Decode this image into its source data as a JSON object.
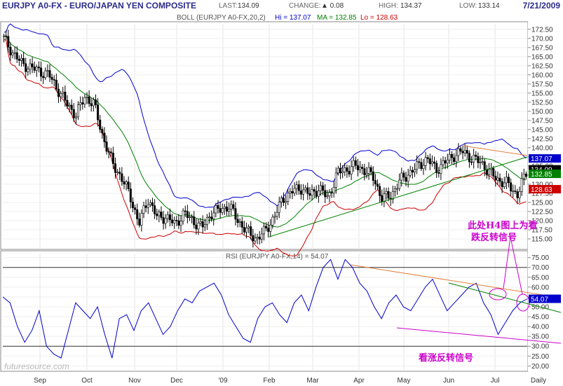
{
  "header": {
    "title": "EURJPY A0-FX - EURO/JAPAN YEN COMPOSITE",
    "last_label": "LAST:",
    "last_value": "134.09",
    "change_label": "CHANGE:",
    "change_value": "▲ 0.08",
    "high_label": "HIGH:",
    "high_value": "134.37",
    "low_label": "LOW:",
    "low_value": "133.14",
    "date": "7/21/2009"
  },
  "colors": {
    "upper_band": "#0000cc",
    "moving_avg": "#008000",
    "lower_band": "#cc0000",
    "rsi": "#0000cc",
    "trend_orange": "#e08040",
    "trend_green": "#008000",
    "annotation": "#cc00cc",
    "price": "#000000"
  },
  "chart_data": [
    {
      "type": "candlestick",
      "legend": {
        "prefix": "BOLL (EURJPY A0-FX,20,2)",
        "hi": "Hi = 137.07",
        "ma": "MA = 132.85",
        "lo": "Lo = 128.63"
      },
      "y_ticks": [
        "172.50",
        "170.00",
        "167.50",
        "165.00",
        "162.50",
        "160.00",
        "157.50",
        "155.00",
        "152.50",
        "150.00",
        "147.50",
        "145.00",
        "142.50",
        "140.00",
        "137.50",
        "135.00",
        "132.50",
        "130.00",
        "127.50",
        "125.00",
        "122.50",
        "120.00",
        "117.50",
        "115.00"
      ],
      "ylim": [
        112.5,
        174
      ],
      "last_tags": [
        {
          "text": "137.07",
          "color": "#0000cc",
          "value": 137.07
        },
        {
          "text": "134.09",
          "color": "#000000",
          "value": 134.09
        },
        {
          "text": "132.85",
          "color": "#008000",
          "value": 132.85
        },
        {
          "text": "128.63",
          "color": "#cc0000",
          "value": 128.63
        }
      ],
      "x_labels": [
        "Sep",
        "Oct",
        "Nov",
        "Dec",
        "'09",
        "Feb",
        "Mar",
        "Apr",
        "May",
        "Jun",
        "Jul",
        "Daily"
      ],
      "close_series": [
        170,
        166,
        163,
        162,
        161,
        160,
        156,
        152,
        149,
        154,
        152,
        143,
        136,
        132,
        127,
        119,
        126,
        121,
        121,
        119,
        122,
        120,
        118,
        122,
        123,
        124,
        120,
        117,
        115,
        117,
        121,
        126,
        128,
        129,
        127,
        129,
        126,
        133,
        134,
        135,
        134,
        132,
        126,
        127,
        131,
        133,
        135,
        137,
        134,
        136,
        138,
        139,
        137,
        136,
        133,
        131,
        130,
        127,
        133
      ]
    },
    {
      "type": "line",
      "legend": "RSI (EURJPY A0-FX,14) = 54.07",
      "y_ticks": [
        "75.00",
        "70.00",
        "65.00",
        "60.00",
        "55.00",
        "50.00",
        "45.00",
        "40.00",
        "35.00",
        "30.00",
        "25.00",
        "20.00"
      ],
      "ylim": [
        18,
        77
      ],
      "ref_lines": [
        70,
        30
      ],
      "last_tag": {
        "text": "54.07",
        "value": 54.07
      },
      "series_values": [
        55,
        52,
        40,
        32,
        38,
        48,
        30,
        26,
        24,
        38,
        52,
        48,
        44,
        50,
        36,
        24,
        44,
        46,
        38,
        48,
        52,
        44,
        36,
        40,
        48,
        54,
        52,
        58,
        60,
        62,
        56,
        46,
        40,
        34,
        32,
        44,
        50,
        52,
        46,
        42,
        52,
        56,
        48,
        60,
        70,
        74,
        64,
        74,
        70,
        62,
        58,
        50,
        44,
        52,
        56,
        50,
        48,
        54,
        60,
        64,
        56,
        48,
        52,
        56,
        60,
        62,
        52,
        46,
        36,
        42,
        48,
        52,
        54.07
      ]
    }
  ],
  "annotations": {
    "bearish_1": "此处H4图上为看",
    "bearish_2": "跌反转信号",
    "bullish": "看涨反转信号"
  },
  "watermark": "futuresource.com"
}
